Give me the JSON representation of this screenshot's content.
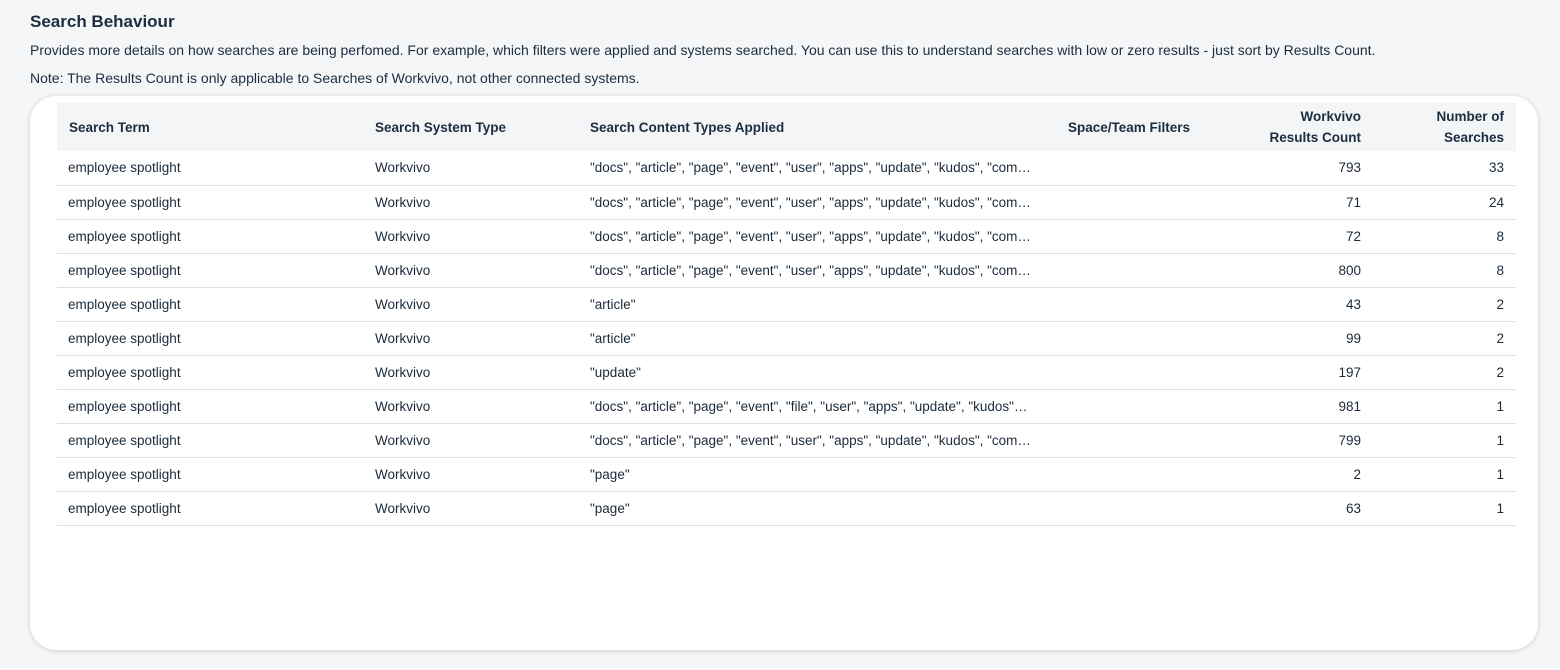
{
  "section": {
    "title": "Search Behaviour",
    "description": "Provides more details on how searches are being perfomed. For example, which filters were applied and systems searched. You can use this to understand searches with low or zero results - just sort by Results Count.",
    "note": "Note: The Results Count is only applicable to Searches of Workvivo, not other connected systems."
  },
  "table": {
    "headers": {
      "search_term": "Search Term",
      "system_type": "Search System Type",
      "content_types": "Search Content Types Applied",
      "filters": "Space/Team Filters",
      "results_count_line1": "Workvivo",
      "results_count_line2": "Results Count",
      "num_searches_line1": "Number of",
      "num_searches_line2": "Searches"
    },
    "rows": [
      {
        "term": "employee spotlight",
        "system": "Workvivo",
        "types": "\"docs\", \"article\", \"page\", \"event\", \"user\", \"apps\", \"update\", \"kudos\", \"com…",
        "filters": "",
        "results": "793",
        "searches": "33"
      },
      {
        "term": "employee spotlight",
        "system": "Workvivo",
        "types": "\"docs\", \"article\", \"page\", \"event\", \"user\", \"apps\", \"update\", \"kudos\", \"com…",
        "filters": "",
        "results": "71",
        "searches": "24"
      },
      {
        "term": "employee spotlight",
        "system": "Workvivo",
        "types": "\"docs\", \"article\", \"page\", \"event\", \"user\", \"apps\", \"update\", \"kudos\", \"com…",
        "filters": "",
        "results": "72",
        "searches": "8"
      },
      {
        "term": "employee spotlight",
        "system": "Workvivo",
        "types": "\"docs\", \"article\", \"page\", \"event\", \"user\", \"apps\", \"update\", \"kudos\", \"com…",
        "filters": "",
        "results": "800",
        "searches": "8"
      },
      {
        "term": "employee spotlight",
        "system": "Workvivo",
        "types": "\"article\"",
        "filters": "",
        "results": "43",
        "searches": "2"
      },
      {
        "term": "employee spotlight",
        "system": "Workvivo",
        "types": "\"article\"",
        "filters": "",
        "results": "99",
        "searches": "2"
      },
      {
        "term": "employee spotlight",
        "system": "Workvivo",
        "types": "\"update\"",
        "filters": "",
        "results": "197",
        "searches": "2"
      },
      {
        "term": "employee spotlight",
        "system": "Workvivo",
        "types": "\"docs\", \"article\", \"page\", \"event\", \"file\", \"user\", \"apps\", \"update\", \"kudos\"…",
        "filters": "",
        "results": "981",
        "searches": "1"
      },
      {
        "term": "employee spotlight",
        "system": "Workvivo",
        "types": "\"docs\", \"article\", \"page\", \"event\", \"user\", \"apps\", \"update\", \"kudos\", \"com…",
        "filters": "",
        "results": "799",
        "searches": "1"
      },
      {
        "term": "employee spotlight",
        "system": "Workvivo",
        "types": "\"page\"",
        "filters": "",
        "results": "2",
        "searches": "1"
      },
      {
        "term": "employee spotlight",
        "system": "Workvivo",
        "types": "\"page\"",
        "filters": "",
        "results": "63",
        "searches": "1"
      }
    ]
  }
}
